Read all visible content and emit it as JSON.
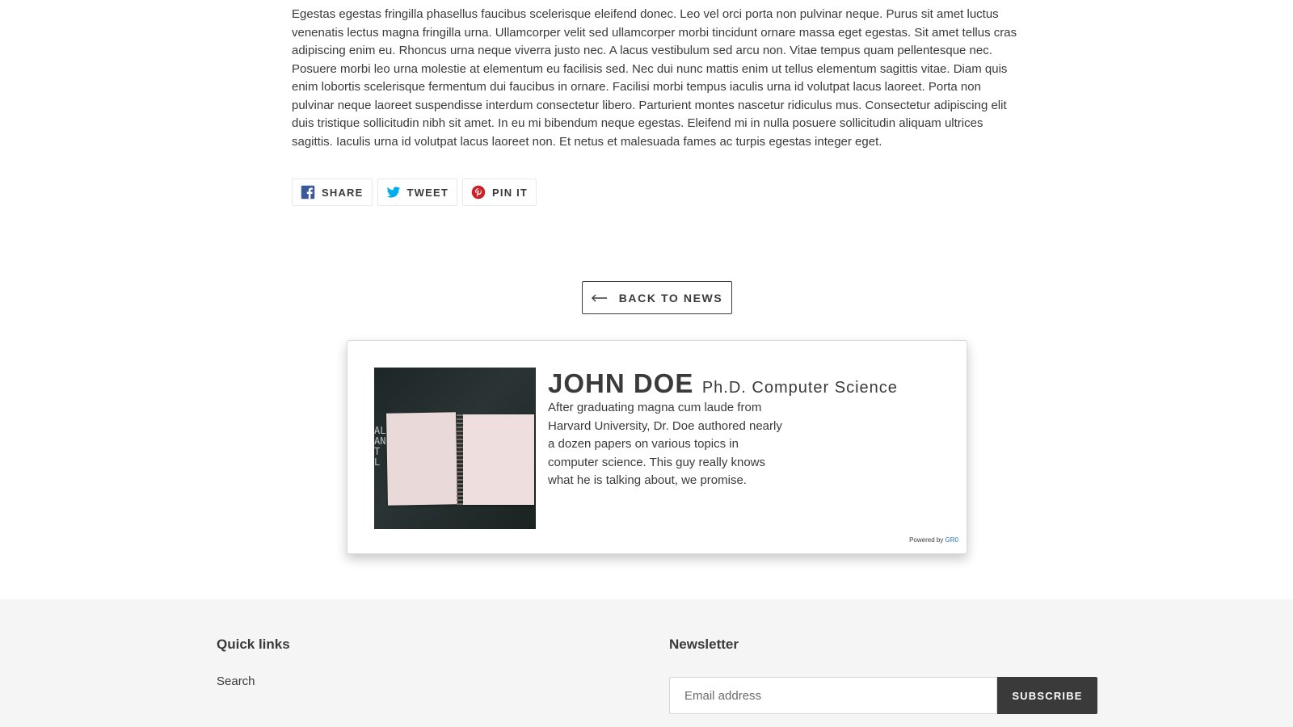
{
  "article": {
    "body": "Egestas egestas fringilla phasellus faucibus scelerisque eleifend donec. Leo vel orci porta non pulvinar neque. Purus sit amet luctus venenatis lectus magna fringilla urna. Ullamcorper velit sed ullamcorper morbi tincidunt ornare massa eget egestas. Sit amet tellus cras adipiscing enim eu. Rhoncus urna neque viverra justo nec. A lacus vestibulum sed arcu non. Vitae tempus quam pellentesque nec. Posuere morbi leo urna molestie at elementum eu facilisis sed. Nec dui nunc mattis enim ut tellus elementum sagittis vitae. Diam quis enim lobortis scelerisque fermentum dui faucibus in ornare. Facilisi morbi tempus iaculis urna id volutpat lacus laoreet. Porta non pulvinar neque laoreet suspendisse interdum consectetur libero. Parturient montes nascetur ridiculus mus. Consectetur adipiscing elit duis tristique sollicitudin nibh sit amet. In eu mi bibendum neque egestas. Eleifend mi in nulla posuere sollicitudin aliquam ultrices sagittis. Iaculis urna id volutpat lacus laoreet non. Et netus et malesuada fames ac turpis egestas integer eget."
  },
  "share": {
    "facebook": {
      "label": "SHARE",
      "icon": "facebook-icon",
      "color": "#3b5998"
    },
    "twitter": {
      "label": "TWEET",
      "icon": "twitter-icon",
      "color": "#00aced"
    },
    "pinterest": {
      "label": "PIN IT",
      "icon": "pinterest-icon",
      "color": "#cb2027"
    }
  },
  "back_to_news": {
    "label": "BACK TO NEWS",
    "icon": "arrow-left-icon"
  },
  "author": {
    "name": "JOHN DOE",
    "title": "Ph.D. Computer Science",
    "bio": "After graduating magna cum laude from Harvard University, Dr. Doe authored nearly a dozen papers on various topics in computer science. This guy really knows what he is talking about, we promise.",
    "photo_chalk_text": "AL\nAN\nT\nL",
    "powered_by_label": "Powered by",
    "powered_by_brand": "GR0",
    "brand_color": "#1a73c8"
  },
  "footer": {
    "quick_links": {
      "heading": "Quick links",
      "items": [
        "Search"
      ]
    },
    "newsletter": {
      "heading": "Newsletter",
      "email_placeholder": "Email address",
      "subscribe_label": "SUBSCRIBE"
    },
    "background": "#f5f5f5"
  }
}
